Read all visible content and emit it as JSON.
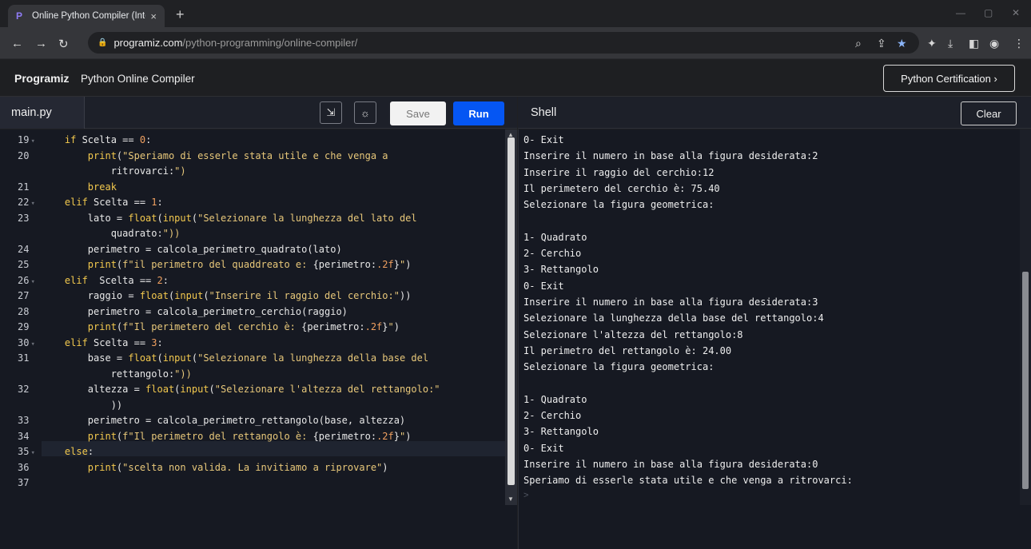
{
  "browser": {
    "tab_title": "Online Python Compiler (Interp",
    "tab_close": "×",
    "new_tab": "+",
    "url_host": "programiz.com",
    "url_path": "/python-programming/online-compiler/",
    "win_min": "—",
    "win_max": "▢",
    "win_close": "✕"
  },
  "site": {
    "logo": "Programiz",
    "title": "Python Online Compiler",
    "cert_label": "Python Certification ›"
  },
  "editor": {
    "file_tab": "main.py",
    "save_label": "Save",
    "run_label": "Run"
  },
  "gutter": [
    {
      "n": "19",
      "fold": true
    },
    {
      "n": "20",
      "fold": false
    },
    {
      "n": "",
      "fold": false
    },
    {
      "n": "21",
      "fold": false
    },
    {
      "n": "22",
      "fold": true
    },
    {
      "n": "23",
      "fold": false
    },
    {
      "n": "",
      "fold": false
    },
    {
      "n": "24",
      "fold": false
    },
    {
      "n": "25",
      "fold": false
    },
    {
      "n": "26",
      "fold": true
    },
    {
      "n": "27",
      "fold": false
    },
    {
      "n": "28",
      "fold": false
    },
    {
      "n": "29",
      "fold": false
    },
    {
      "n": "30",
      "fold": true
    },
    {
      "n": "31",
      "fold": false
    },
    {
      "n": "",
      "fold": false
    },
    {
      "n": "32",
      "fold": false
    },
    {
      "n": "",
      "fold": false
    },
    {
      "n": "33",
      "fold": false
    },
    {
      "n": "34",
      "fold": false
    },
    {
      "n": "35",
      "fold": true
    },
    {
      "n": "36",
      "fold": false
    },
    {
      "n": "37",
      "fold": false
    }
  ],
  "code_lines": [
    "    if Scelta == 0:",
    "        print(\"Speriamo di esserle stata utile e che venga a",
    "            ritrovarci:\")",
    "        break",
    "    elif Scelta == 1:",
    "        lato = float(input(\"Selezionare la lunghezza del lato del",
    "            quadrato:\"))",
    "        perimetro = calcola_perimetro_quadrato(lato)",
    "        print(f\"il perimetro del quaddreato e: {perimetro:.2f}\")",
    "    elif  Scelta == 2:",
    "        raggio = float(input(\"Inserire il raggio del cerchio:\"))",
    "        perimetro = calcola_perimetro_cerchio(raggio)",
    "        print(f\"Il perimetero del cerchio è: {perimetro:.2f}\")",
    "    elif Scelta == 3:",
    "        base = float(input(\"Selezionare la lunghezza della base del",
    "            rettangolo:\"))",
    "        altezza = float(input(\"Selezionare l'altezza del rettangolo:\"",
    "            ))",
    "        perimetro = calcola_perimetro_rettangolo(base, altezza)",
    "        print(f\"Il perimetro del rettangolo è: {perimetro:.2f}\")",
    "    else:",
    "        print(\"scelta non valida. La invitiamo a riprovare\")",
    ""
  ],
  "shell": {
    "title": "Shell",
    "clear_label": "Clear",
    "prompt": ">",
    "lines": [
      "0- Exit",
      "Inserire il numero in base alla figura desiderata:2",
      "Inserire il raggio del cerchio:12",
      "Il perimetero del cerchio è: 75.40",
      "Selezionare la figura geometrica:",
      "",
      "1- Quadrato",
      "2- Cerchio",
      "3- Rettangolo",
      "0- Exit",
      "Inserire il numero in base alla figura desiderata:3",
      "Selezionare la lunghezza della base del rettangolo:4",
      "Selezionare l'altezza del rettangolo:8",
      "Il perimetro del rettangolo è: 24.00",
      "Selezionare la figura geometrica:",
      "",
      "1- Quadrato",
      "2- Cerchio",
      "3- Rettangolo",
      "0- Exit",
      "Inserire il numero in base alla figura desiderata:0",
      "Speriamo di esserle stata utile e che venga a ritrovarci:"
    ]
  }
}
